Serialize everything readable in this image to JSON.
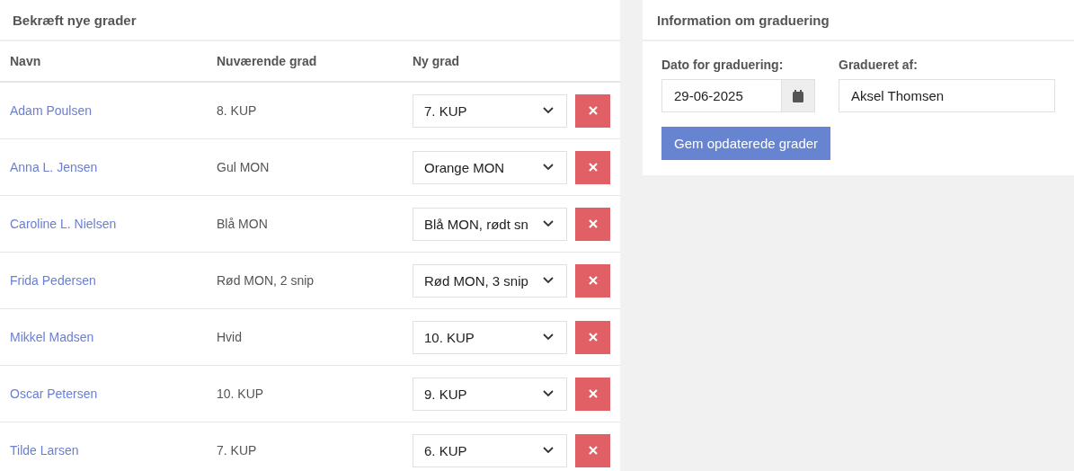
{
  "left_panel": {
    "title": "Bekræft nye grader",
    "columns": [
      "Navn",
      "Nuværende grad",
      "Ny grad"
    ],
    "rows": [
      {
        "name": "Adam Poulsen",
        "current": "8. KUP",
        "new": "7. KUP"
      },
      {
        "name": "Anna L. Jensen",
        "current": "Gul MON",
        "new": "Orange MON"
      },
      {
        "name": "Caroline L. Nielsen",
        "current": "Blå MON",
        "new": "Blå MON, rødt sn"
      },
      {
        "name": "Frida Pedersen",
        "current": "Rød MON, 2 snip",
        "new": "Rød MON, 3 snip"
      },
      {
        "name": "Mikkel Madsen",
        "current": "Hvid",
        "new": "10. KUP"
      },
      {
        "name": "Oscar Petersen",
        "current": "10. KUP",
        "new": "9. KUP"
      },
      {
        "name": "Tilde Larsen",
        "current": "7. KUP",
        "new": "6. KUP"
      }
    ]
  },
  "right_panel": {
    "title": "Information om graduering",
    "date_label": "Dato for graduering:",
    "date_value": "29-06-2025",
    "by_label": "Gradueret af:",
    "by_value": "Aksel Thomsen",
    "save_button": "Gem opdaterede grader"
  }
}
